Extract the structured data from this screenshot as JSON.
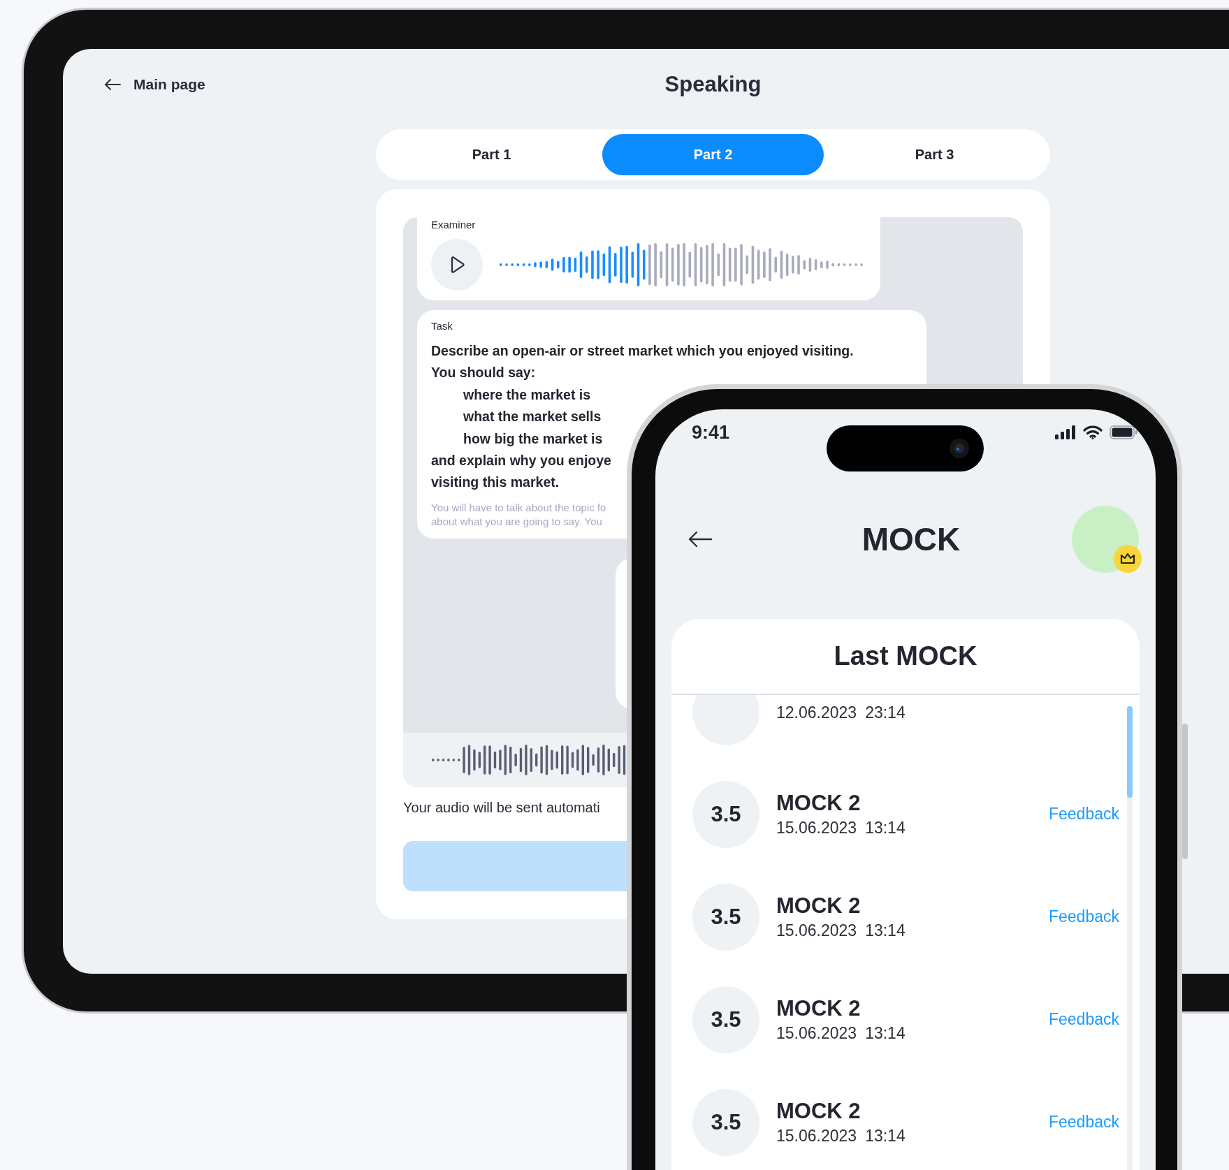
{
  "tablet": {
    "back_link": {
      "label": "Main page"
    },
    "title": "Speaking",
    "tabs": [
      {
        "label": "Part 1",
        "selected": false
      },
      {
        "label": "Part 2",
        "selected": true
      },
      {
        "label": "Part 3",
        "selected": false
      }
    ],
    "examiner": {
      "label": "Examiner",
      "level": 0.4
    },
    "task": {
      "label": "Task",
      "lines": [
        {
          "kind": "main",
          "text": "Describe an open-air or street market which you enjoyed visiting."
        },
        {
          "kind": "main",
          "text": "You should say:"
        },
        {
          "kind": "indent",
          "text": "where the market is"
        },
        {
          "kind": "indent",
          "text": "what the market sells"
        },
        {
          "kind": "indent",
          "text": "how big the market is"
        },
        {
          "kind": "main",
          "text": "and explain why you enjoye"
        },
        {
          "kind": "main",
          "text": "visiting this market."
        }
      ],
      "note": [
        "You will have to talk about the topic fo",
        "about what you are going to say. You"
      ]
    },
    "audio_notice": "Your audio will be sent automati"
  },
  "phone": {
    "status_bar": {
      "time": "9:41"
    },
    "title": "MOCK",
    "list_title": "Last MOCK",
    "results": [
      {
        "date": "12.06.2023",
        "time": "23:14"
      },
      {
        "score": "3.5",
        "title": "MOCK 2",
        "date": "15.06.2023",
        "time": "13:14",
        "link": "Feedback"
      },
      {
        "score": "3.5",
        "title": "MOCK 2",
        "date": "15.06.2023",
        "time": "13:14",
        "link": "Feedback"
      },
      {
        "score": "3.5",
        "title": "MOCK 2",
        "date": "15.06.2023",
        "time": "13:14",
        "link": "Feedback"
      },
      {
        "score": "3.5",
        "title": "MOCK 2",
        "date": "15.06.2023",
        "time": "13:14",
        "link": "Feedback"
      }
    ]
  }
}
